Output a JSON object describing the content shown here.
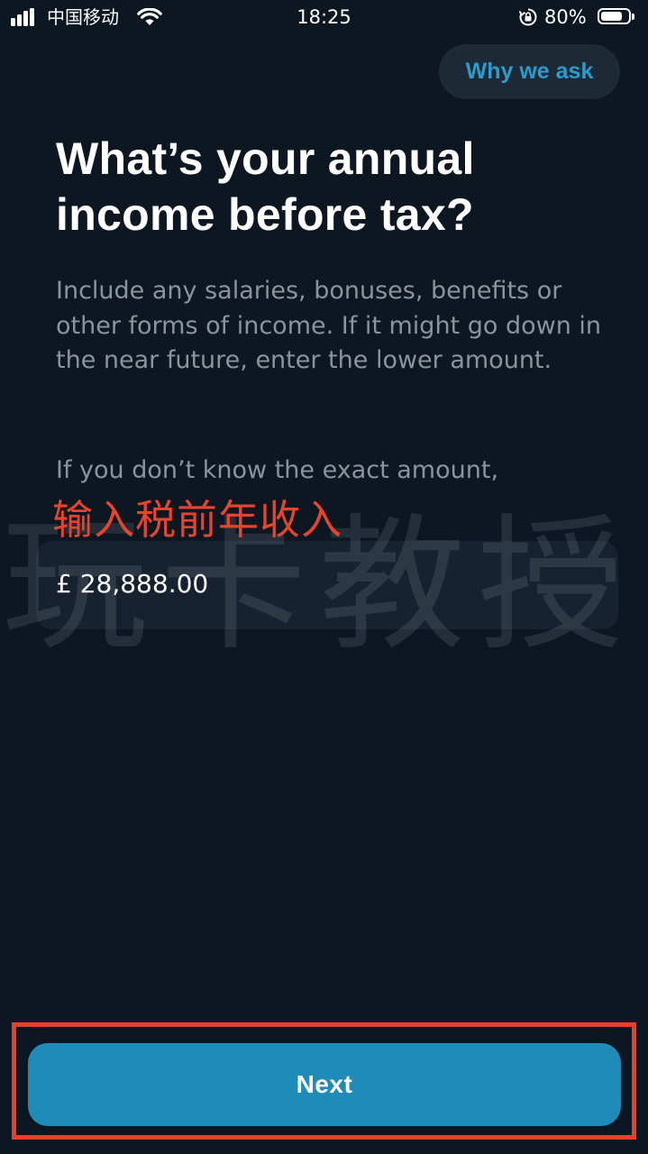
{
  "status_bar": {
    "carrier": "中国移动",
    "time": "18:25",
    "battery_percent": "80%",
    "battery_level": 0.8,
    "icons": [
      "signal-icon",
      "wifi-icon",
      "orientation-lock-icon",
      "battery-icon"
    ]
  },
  "header": {
    "why_button_label": "Why we ask"
  },
  "main": {
    "title": "What’s your annual income before tax?",
    "description": "Include any salaries, bonuses, benefits or other forms of income. If it might go down in the near future, enter the lower amount.",
    "hint": "If you don’t know the exact amount,",
    "income_value": "£ 28,888.00"
  },
  "annotation": {
    "text": "输入税前年收入",
    "watermark": "玩卡教授"
  },
  "footer": {
    "next_label": "Next"
  },
  "colors": {
    "background": "#0c1722",
    "accent": "#1f8bb8",
    "link": "#2a9ccd",
    "annotation_red": "#e8442c",
    "muted_text": "#8a949c"
  }
}
